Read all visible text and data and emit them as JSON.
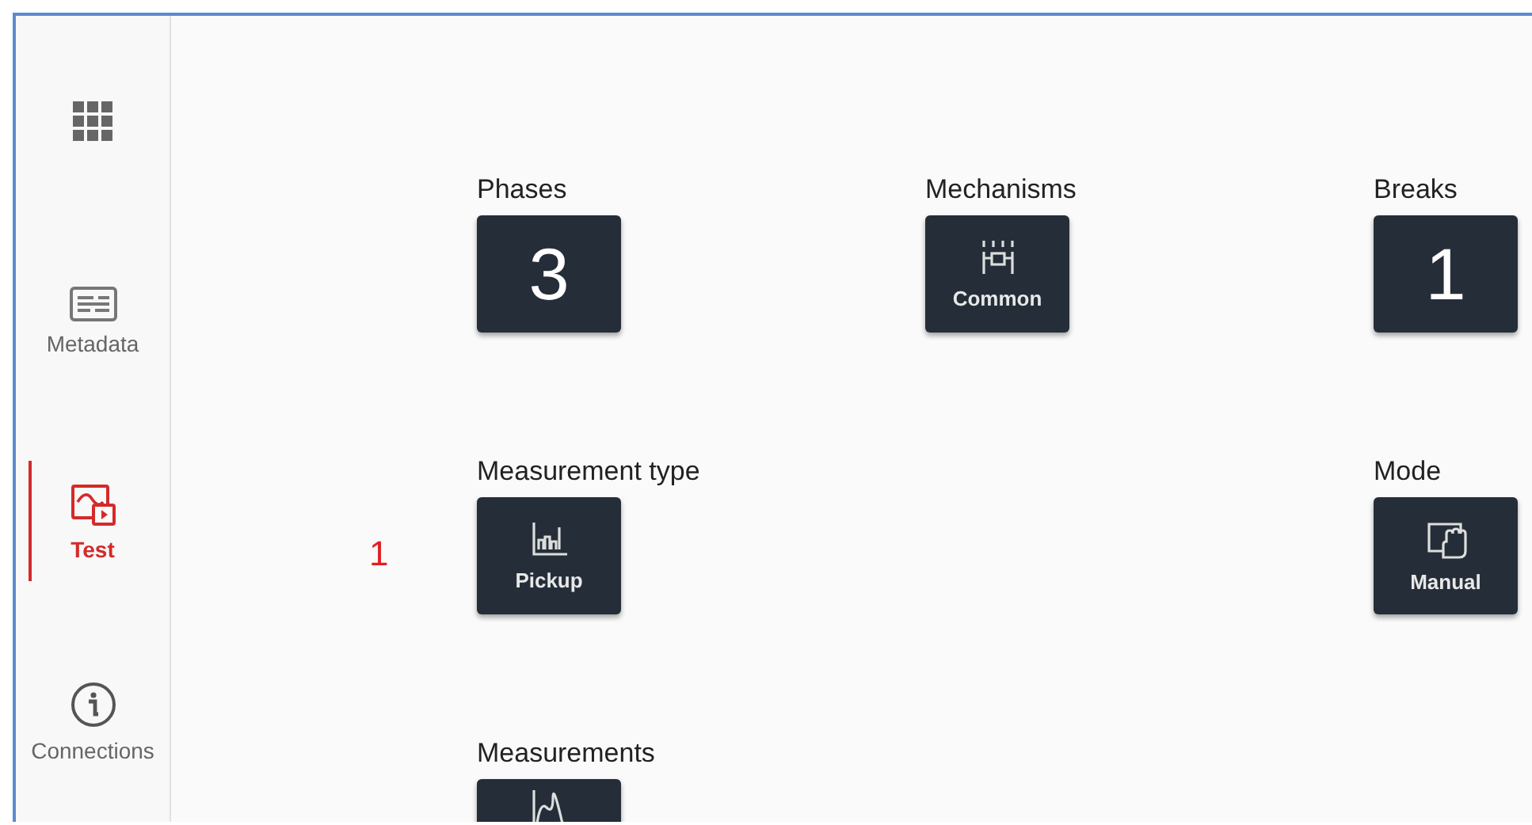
{
  "sidebar": {
    "items": [
      {
        "kind": "apps",
        "selected": false
      },
      {
        "kind": "metadata",
        "label": "Metadata",
        "selected": false
      },
      {
        "kind": "test",
        "label": "Test",
        "selected": true
      },
      {
        "kind": "info",
        "label": "Connections",
        "selected": false
      }
    ]
  },
  "annotation": "1",
  "settings": [
    [
      {
        "title": "Phases",
        "kind": "number",
        "value": "3"
      },
      {
        "title": "Mechanisms",
        "kind": "icon",
        "value": "Common"
      },
      {
        "title": "Breaks",
        "kind": "number",
        "value": "1"
      }
    ],
    [
      {
        "title": "Measurement type",
        "kind": "icon",
        "value": "Pickup"
      },
      {
        "title": "Mode",
        "kind": "icon",
        "value": "Manual"
      }
    ],
    [
      {
        "title": "Measurements",
        "kind": "icon"
      }
    ]
  ]
}
